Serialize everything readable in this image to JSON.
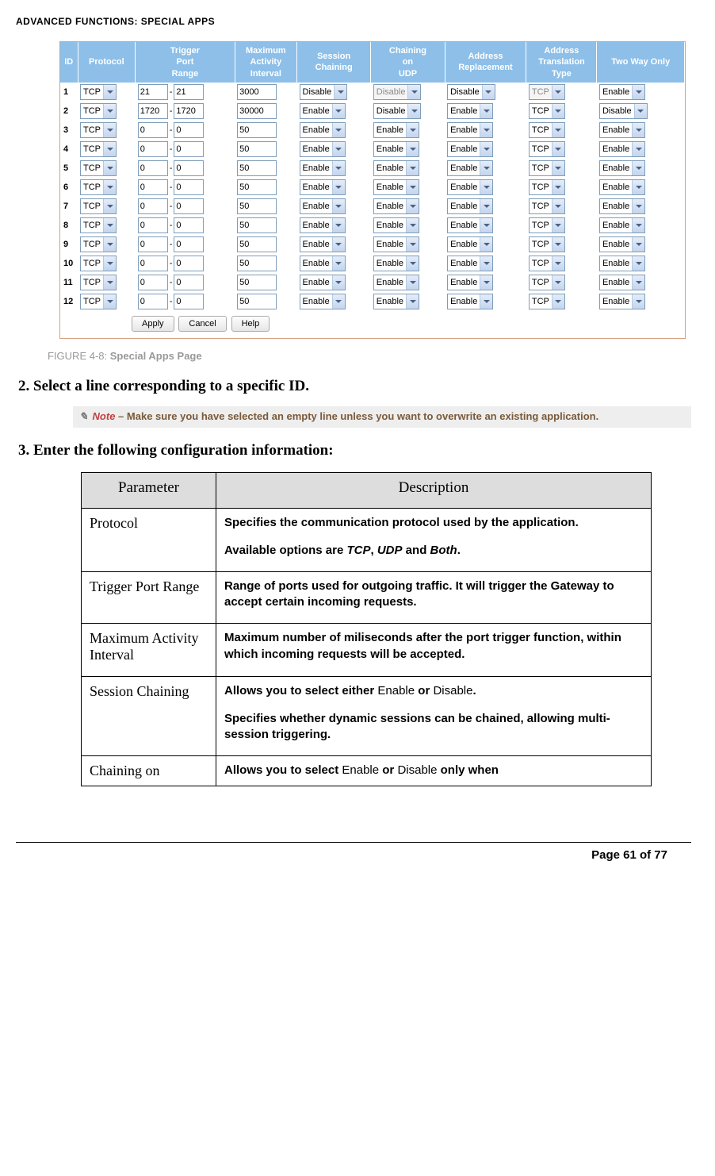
{
  "header": "ADVANCED FUNCTIONS: SPECIAL APPS",
  "config": {
    "columns": [
      "ID",
      "Protocol",
      "Trigger Port Range",
      "Maximum Activity Interval",
      "Session Chaining",
      "Chaining on UDP",
      "Address Replacement",
      "Address Translation Type",
      "Two Way Only"
    ],
    "rows": [
      {
        "id": "1",
        "protocol": "TCP",
        "port_from": "21",
        "port_to": "21",
        "max": "3000",
        "session": "Disable",
        "udp": "Disable",
        "udp_disabled": true,
        "addr_repl": "Disable",
        "addr_trans": "TCP",
        "addr_trans_disabled": true,
        "two_way": "Enable"
      },
      {
        "id": "2",
        "protocol": "TCP",
        "port_from": "1720",
        "port_to": "1720",
        "max": "30000",
        "session": "Enable",
        "udp": "Disable",
        "udp_disabled": false,
        "addr_repl": "Enable",
        "addr_trans": "TCP",
        "addr_trans_disabled": false,
        "two_way": "Disable"
      },
      {
        "id": "3",
        "protocol": "TCP",
        "port_from": "0",
        "port_to": "0",
        "max": "50",
        "session": "Enable",
        "udp": "Enable",
        "udp_disabled": false,
        "addr_repl": "Enable",
        "addr_trans": "TCP",
        "addr_trans_disabled": false,
        "two_way": "Enable"
      },
      {
        "id": "4",
        "protocol": "TCP",
        "port_from": "0",
        "port_to": "0",
        "max": "50",
        "session": "Enable",
        "udp": "Enable",
        "udp_disabled": false,
        "addr_repl": "Enable",
        "addr_trans": "TCP",
        "addr_trans_disabled": false,
        "two_way": "Enable"
      },
      {
        "id": "5",
        "protocol": "TCP",
        "port_from": "0",
        "port_to": "0",
        "max": "50",
        "session": "Enable",
        "udp": "Enable",
        "udp_disabled": false,
        "addr_repl": "Enable",
        "addr_trans": "TCP",
        "addr_trans_disabled": false,
        "two_way": "Enable"
      },
      {
        "id": "6",
        "protocol": "TCP",
        "port_from": "0",
        "port_to": "0",
        "max": "50",
        "session": "Enable",
        "udp": "Enable",
        "udp_disabled": false,
        "addr_repl": "Enable",
        "addr_trans": "TCP",
        "addr_trans_disabled": false,
        "two_way": "Enable"
      },
      {
        "id": "7",
        "protocol": "TCP",
        "port_from": "0",
        "port_to": "0",
        "max": "50",
        "session": "Enable",
        "udp": "Enable",
        "udp_disabled": false,
        "addr_repl": "Enable",
        "addr_trans": "TCP",
        "addr_trans_disabled": false,
        "two_way": "Enable"
      },
      {
        "id": "8",
        "protocol": "TCP",
        "port_from": "0",
        "port_to": "0",
        "max": "50",
        "session": "Enable",
        "udp": "Enable",
        "udp_disabled": false,
        "addr_repl": "Enable",
        "addr_trans": "TCP",
        "addr_trans_disabled": false,
        "two_way": "Enable"
      },
      {
        "id": "9",
        "protocol": "TCP",
        "port_from": "0",
        "port_to": "0",
        "max": "50",
        "session": "Enable",
        "udp": "Enable",
        "udp_disabled": false,
        "addr_repl": "Enable",
        "addr_trans": "TCP",
        "addr_trans_disabled": false,
        "two_way": "Enable"
      },
      {
        "id": "10",
        "protocol": "TCP",
        "port_from": "0",
        "port_to": "0",
        "max": "50",
        "session": "Enable",
        "udp": "Enable",
        "udp_disabled": false,
        "addr_repl": "Enable",
        "addr_trans": "TCP",
        "addr_trans_disabled": false,
        "two_way": "Enable"
      },
      {
        "id": "11",
        "protocol": "TCP",
        "port_from": "0",
        "port_to": "0",
        "max": "50",
        "session": "Enable",
        "udp": "Enable",
        "udp_disabled": false,
        "addr_repl": "Enable",
        "addr_trans": "TCP",
        "addr_trans_disabled": false,
        "two_way": "Enable"
      },
      {
        "id": "12",
        "protocol": "TCP",
        "port_from": "0",
        "port_to": "0",
        "max": "50",
        "session": "Enable",
        "udp": "Enable",
        "udp_disabled": false,
        "addr_repl": "Enable",
        "addr_trans": "TCP",
        "addr_trans_disabled": false,
        "two_way": "Enable"
      }
    ],
    "buttons": {
      "apply": "Apply",
      "cancel": "Cancel",
      "help": "Help"
    }
  },
  "figure": {
    "label": "FIGURE 4-8:",
    "title": "Special Apps Page"
  },
  "step2": "Select a line corresponding to a specific ID.",
  "note": {
    "word": "Note",
    "sep": "–",
    "text": "Make sure you have selected an empty line unless you want to overwrite an existing application."
  },
  "step3": "Enter the following configuration information:",
  "param_table": {
    "head": {
      "param": "Parameter",
      "desc": "Description"
    },
    "rows": [
      {
        "name": "Protocol",
        "desc_lines": [
          {
            "t": "Specifies the communication protocol used by the application."
          },
          {
            "spacer": true
          },
          {
            "html": "Available options are <span class=\"opt\">TCP</span>, <span class=\"opt\">UDP</span> and <span class=\"opt\">Both</span>."
          }
        ]
      },
      {
        "name": "Trigger Port Range",
        "desc_lines": [
          {
            "t": "Range of ports used for outgoing traffic. It will trigger the Gateway to accept certain incoming requests."
          }
        ]
      },
      {
        "name": "Maximum Activity Interval",
        "desc_lines": [
          {
            "t": "Maximum number of miliseconds after the port trigger function, within which incoming requests will be accepted."
          }
        ]
      },
      {
        "name": "Session Chaining",
        "desc_lines": [
          {
            "html": "Allows you to select either <span class=\"normal\">Enable</span> or <span class=\"normal\">Disable</span>."
          },
          {
            "spacer": true
          },
          {
            "t": "Specifies whether dynamic sessions can be chained, allowing multi-session triggering."
          }
        ]
      },
      {
        "name": "Chaining on",
        "desc_lines": [
          {
            "html": "Allows you to select <span class=\"normal\">Enable</span> or <span class=\"normal\">Disable</span> only when"
          }
        ],
        "tight": true
      }
    ]
  },
  "footer": "Page 61 of 77"
}
